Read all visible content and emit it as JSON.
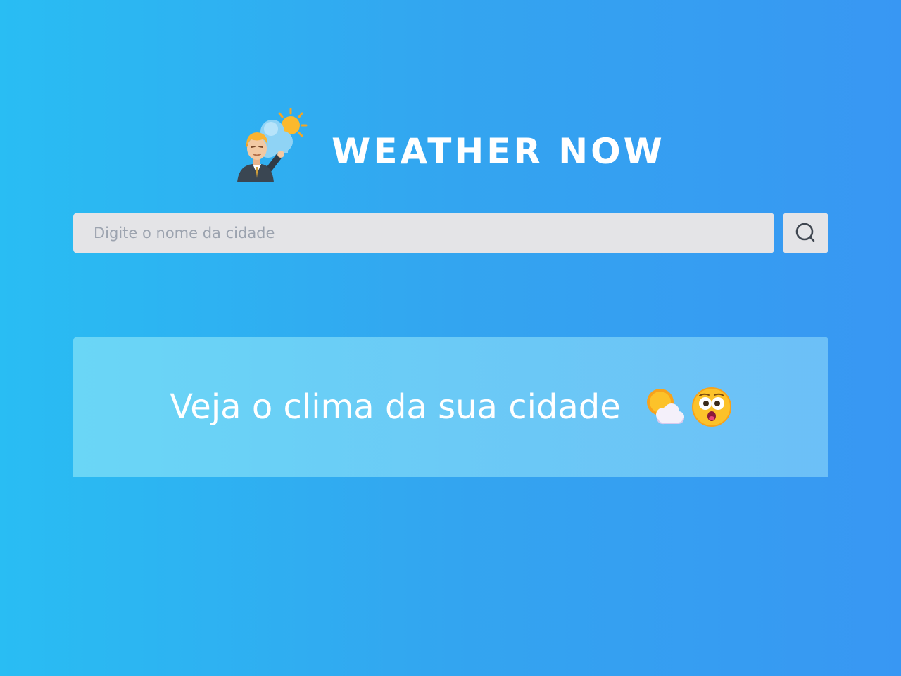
{
  "header": {
    "title": "WEATHER NOW",
    "logo_icon": "weather-presenter-icon"
  },
  "search": {
    "placeholder": "Digite o nome da cidade",
    "value": "",
    "button_icon": "search-icon"
  },
  "panel": {
    "message": "Veja o clima da sua cidade",
    "emojis": [
      "sun-behind-cloud-icon",
      "astonished-face-icon"
    ]
  },
  "colors": {
    "background_start": "#29bdf3",
    "background_end": "#3897f3",
    "input_background": "#e4e4e7",
    "text": "#ffffff"
  }
}
